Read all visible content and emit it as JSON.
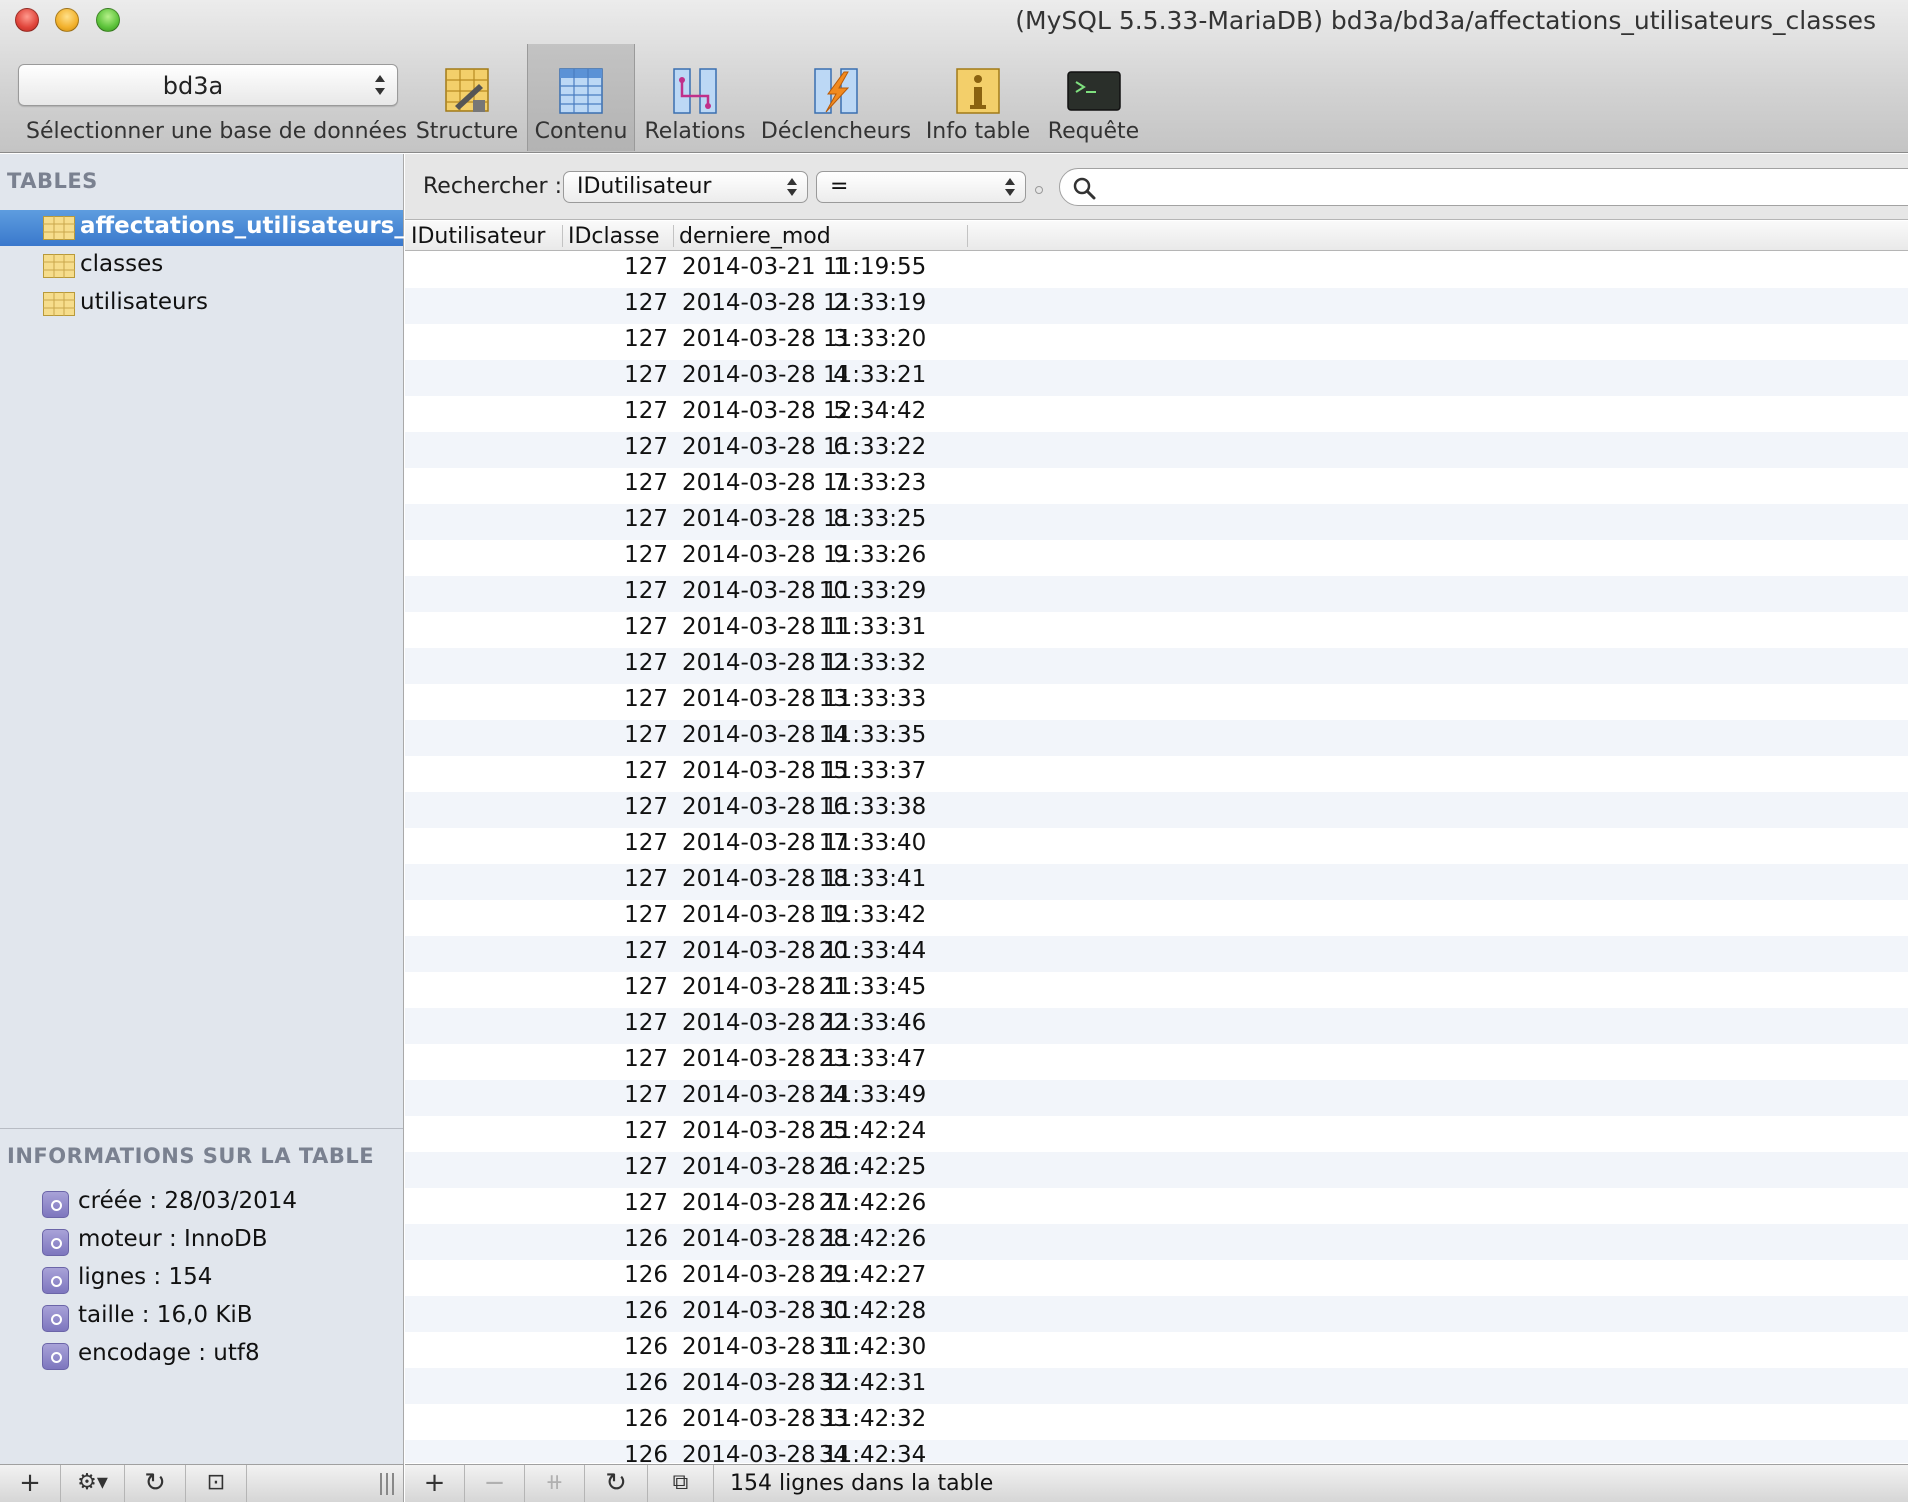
{
  "window": {
    "title": "(MySQL 5.5.33-MariaDB) bd3a/bd3a/affectations_utilisateurs_classes"
  },
  "toolbar": {
    "database_select": {
      "value": "bd3a",
      "label": "Sélectionner une base de données"
    },
    "buttons": [
      {
        "label": "Structure",
        "icon": "structure-icon"
      },
      {
        "label": "Contenu",
        "icon": "content-grid-icon",
        "active": true
      },
      {
        "label": "Relations",
        "icon": "relations-icon"
      },
      {
        "label": "Déclencheurs",
        "icon": "triggers-icon"
      },
      {
        "label": "Info table",
        "icon": "info-icon"
      },
      {
        "label": "Requête",
        "icon": "terminal-icon"
      }
    ]
  },
  "sidebar": {
    "tables_heading": "TABLES",
    "tables": [
      {
        "label": "affectations_utilisateurs_...",
        "selected": true
      },
      {
        "label": "classes"
      },
      {
        "label": "utilisateurs"
      }
    ],
    "info_heading": "INFORMATIONS SUR LA TABLE",
    "info": [
      "créée : 28/03/2014",
      "moteur : InnoDB",
      "lignes : 154",
      "taille : 16,0 KiB",
      "encodage : utf8"
    ]
  },
  "filter": {
    "label": "Rechercher :",
    "field": "IDutilisateur",
    "operator": "=",
    "search_value": ""
  },
  "grid": {
    "columns": [
      "IDutilisateur",
      "IDclasse",
      "derniere_mod"
    ],
    "rows": [
      [
        "1",
        "127",
        "2014-03-21 11:19:55"
      ],
      [
        "2",
        "127",
        "2014-03-28 11:33:19"
      ],
      [
        "3",
        "127",
        "2014-03-28 11:33:20"
      ],
      [
        "4",
        "127",
        "2014-03-28 11:33:21"
      ],
      [
        "5",
        "127",
        "2014-03-28 12:34:42"
      ],
      [
        "6",
        "127",
        "2014-03-28 11:33:22"
      ],
      [
        "7",
        "127",
        "2014-03-28 11:33:23"
      ],
      [
        "8",
        "127",
        "2014-03-28 11:33:25"
      ],
      [
        "9",
        "127",
        "2014-03-28 11:33:26"
      ],
      [
        "10",
        "127",
        "2014-03-28 11:33:29"
      ],
      [
        "11",
        "127",
        "2014-03-28 11:33:31"
      ],
      [
        "12",
        "127",
        "2014-03-28 11:33:32"
      ],
      [
        "13",
        "127",
        "2014-03-28 11:33:33"
      ],
      [
        "14",
        "127",
        "2014-03-28 11:33:35"
      ],
      [
        "15",
        "127",
        "2014-03-28 11:33:37"
      ],
      [
        "16",
        "127",
        "2014-03-28 11:33:38"
      ],
      [
        "17",
        "127",
        "2014-03-28 11:33:40"
      ],
      [
        "18",
        "127",
        "2014-03-28 11:33:41"
      ],
      [
        "19",
        "127",
        "2014-03-28 11:33:42"
      ],
      [
        "20",
        "127",
        "2014-03-28 11:33:44"
      ],
      [
        "21",
        "127",
        "2014-03-28 11:33:45"
      ],
      [
        "22",
        "127",
        "2014-03-28 11:33:46"
      ],
      [
        "23",
        "127",
        "2014-03-28 11:33:47"
      ],
      [
        "24",
        "127",
        "2014-03-28 11:33:49"
      ],
      [
        "25",
        "127",
        "2014-03-28 11:42:24"
      ],
      [
        "26",
        "127",
        "2014-03-28 11:42:25"
      ],
      [
        "27",
        "127",
        "2014-03-28 11:42:26"
      ],
      [
        "28",
        "126",
        "2014-03-28 11:42:26"
      ],
      [
        "29",
        "126",
        "2014-03-28 11:42:27"
      ],
      [
        "30",
        "126",
        "2014-03-28 11:42:28"
      ],
      [
        "31",
        "126",
        "2014-03-28 11:42:30"
      ],
      [
        "32",
        "126",
        "2014-03-28 11:42:31"
      ],
      [
        "33",
        "126",
        "2014-03-28 11:42:32"
      ],
      [
        "34",
        "126",
        "2014-03-28 11:42:34"
      ]
    ]
  },
  "footer": {
    "status": "154 lignes dans la table"
  },
  "colors": {
    "selection": "#3a78cc",
    "row_alt": "#f2f5fa",
    "sidebar_bg": "#e1e6ed"
  }
}
